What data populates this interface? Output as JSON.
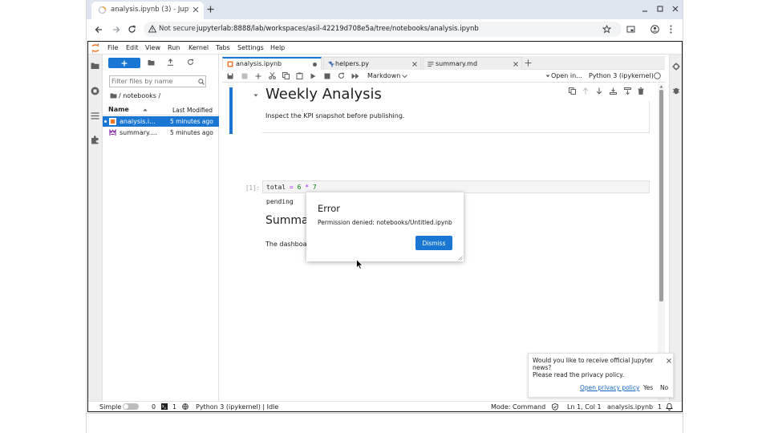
{
  "browser": {
    "tab_title": "analysis.ipynb (3) - Jupyt",
    "security_label": "Not secure",
    "url": "jupyterlab:8888/lab/workspaces/asil-42219d708e5a/tree/notebooks/analysis.ipynb"
  },
  "menubar": [
    "File",
    "Edit",
    "View",
    "Run",
    "Kernel",
    "Tabs",
    "Settings",
    "Help"
  ],
  "filebrowser": {
    "filter_placeholder": "Filter files by name",
    "breadcrumb": "/ notebooks /",
    "col_name": "Name",
    "col_modified": "Last Modified",
    "files": [
      {
        "name": "analysis.i...",
        "modified": "5 minutes ago"
      },
      {
        "name": "summary....",
        "modified": "5 minutes ago"
      }
    ]
  },
  "doc_tabs": [
    {
      "label": "analysis.ipynb"
    },
    {
      "label": "helpers.py"
    },
    {
      "label": "summary.md"
    }
  ],
  "nb_toolbar": {
    "cell_type": "Markdown",
    "open_in": "Open in...",
    "kernel": "Python 3 (ipykernel)"
  },
  "notebook": {
    "heading1": "Weekly Analysis",
    "para1": "Inspect the KPI snapshot before publishing.",
    "prompt": "[1]:",
    "code_var": "total",
    "code_eq": "=",
    "code_a": "6",
    "code_op": "*",
    "code_b": "7",
    "output": "pending",
    "heading2": "Summary",
    "para2": "The dashboa"
  },
  "dialog": {
    "title": "Error",
    "message": "Permission denied: notebooks/Untitled.ipynb",
    "dismiss": "Dismiss"
  },
  "toast": {
    "line1": "Would you like to receive official Jupyter",
    "line2": "news?",
    "line3": "Please read the privacy policy.",
    "policy_link": "Open privacy policy",
    "yes": "Yes",
    "no": "No"
  },
  "statusbar": {
    "mode_label": "Simple",
    "count_a": "0",
    "count_b": "1",
    "kernel_status": "Python 3 (ipykernel) | Idle",
    "mode": "Mode: Command",
    "position": "Ln 1, Col 1",
    "file": "analysis.ipynb",
    "notifications": "1"
  }
}
